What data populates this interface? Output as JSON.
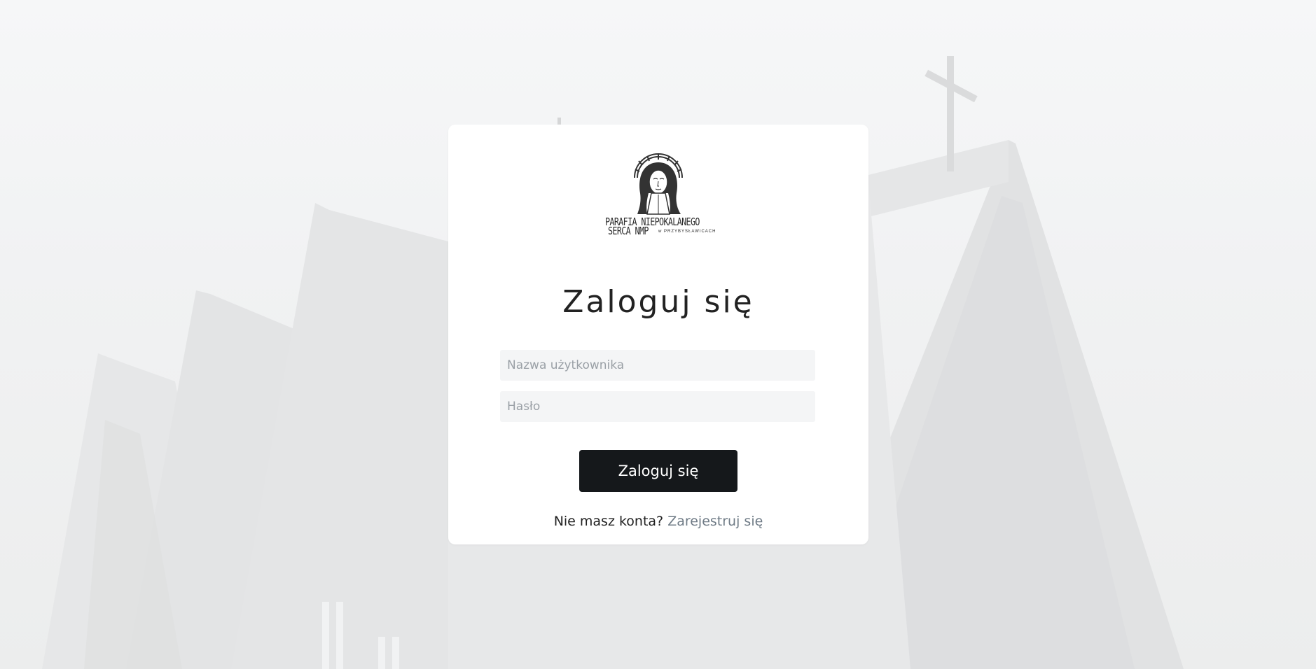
{
  "logo": {
    "caption_line1": "PARAFIA NIEPOKALANEGO",
    "caption_line2": "SERCA NMP",
    "caption_small": "w PRZYBYSŁAWICACH"
  },
  "login": {
    "title": "Zaloguj się",
    "username_placeholder": "Nazwa użytkownika",
    "password_placeholder": "Hasło",
    "submit_label": "Zaloguj się",
    "no_account_text": "Nie masz konta?",
    "register_link": "Zarejestruj się"
  },
  "colors": {
    "button_bg": "#15181b",
    "link": "#6f7b86",
    "input_bg": "#f4f5f6"
  }
}
